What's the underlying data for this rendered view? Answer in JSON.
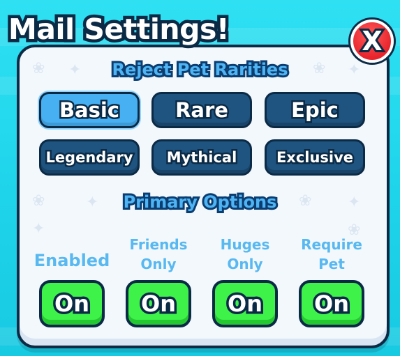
{
  "window": {
    "title": "Mail Settings!",
    "close_label": "X"
  },
  "rarities": {
    "heading": "Reject Pet Rarities",
    "items": [
      {
        "label": "Basic",
        "selected": true
      },
      {
        "label": "Rare",
        "selected": false
      },
      {
        "label": "Epic",
        "selected": false
      },
      {
        "label": "Legendary",
        "selected": false
      },
      {
        "label": "Mythical",
        "selected": false
      },
      {
        "label": "Exclusive",
        "selected": false
      }
    ]
  },
  "primary": {
    "heading": "Primary Options",
    "options": [
      {
        "label": "Enabled",
        "state": "On"
      },
      {
        "label": "Friends\nOnly",
        "state": "On"
      },
      {
        "label": "Huges\nOnly",
        "state": "On"
      },
      {
        "label": "Require\nPet",
        "state": "On"
      }
    ]
  },
  "colors": {
    "background": "#1ed4ea",
    "panel": "#f3f8fd",
    "outline": "#0b2a45",
    "button_dark": "#1f5480",
    "button_selected": "#47b0f2",
    "toggle_on": "#3ef24a",
    "close": "#e8232c",
    "label": "#58b8f0"
  },
  "icons": {
    "close": "close-x-icon",
    "background_pattern": "paw-print-icon"
  }
}
